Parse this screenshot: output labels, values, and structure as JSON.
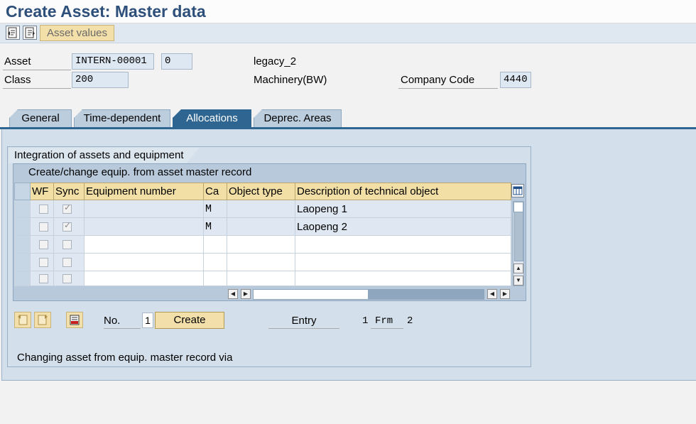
{
  "window": {
    "title": "Create Asset:  Master data"
  },
  "toolbar": {
    "asset_values_label": "Asset values"
  },
  "header": {
    "asset_label": "Asset",
    "asset_number": "INTERN-00001",
    "asset_subnumber": "0",
    "asset_description": "legacy_2",
    "class_label": "Class",
    "class_value": "200",
    "class_description": "Machinery(BW)",
    "company_code_label": "Company Code",
    "company_code_value": "4440"
  },
  "tabs": [
    {
      "label": "General",
      "active": false
    },
    {
      "label": "Time-dependent",
      "active": false
    },
    {
      "label": "Allocations",
      "active": true
    },
    {
      "label": "Deprec. Areas",
      "active": false
    }
  ],
  "group": {
    "title": "Integration of assets and equipment",
    "table_caption": "Create/change equip. from asset master record",
    "columns": [
      "WF",
      "Sync",
      "Equipment number",
      "Ca",
      "Object type",
      "Description of technical object"
    ],
    "rows": [
      {
        "wf": false,
        "sync": true,
        "equipment_number": "",
        "ca": "M",
        "object_type": "",
        "description": "Laopeng 1"
      },
      {
        "wf": false,
        "sync": true,
        "equipment_number": "",
        "ca": "M",
        "object_type": "",
        "description": "Laopeng 2"
      },
      {
        "wf": false,
        "sync": false,
        "equipment_number": "",
        "ca": "",
        "object_type": "",
        "description": ""
      },
      {
        "wf": false,
        "sync": false,
        "equipment_number": "",
        "ca": "",
        "object_type": "",
        "description": ""
      },
      {
        "wf": false,
        "sync": false,
        "equipment_number": "",
        "ca": "",
        "object_type": "",
        "description": ""
      }
    ]
  },
  "bottom": {
    "no_label": "No.",
    "no_value": "1",
    "create_label": "Create",
    "entry_label": "Entry",
    "entry_current": "1",
    "frm_label": "Frm",
    "entry_total": "2",
    "status_text": "Changing asset from equip. master record via"
  }
}
